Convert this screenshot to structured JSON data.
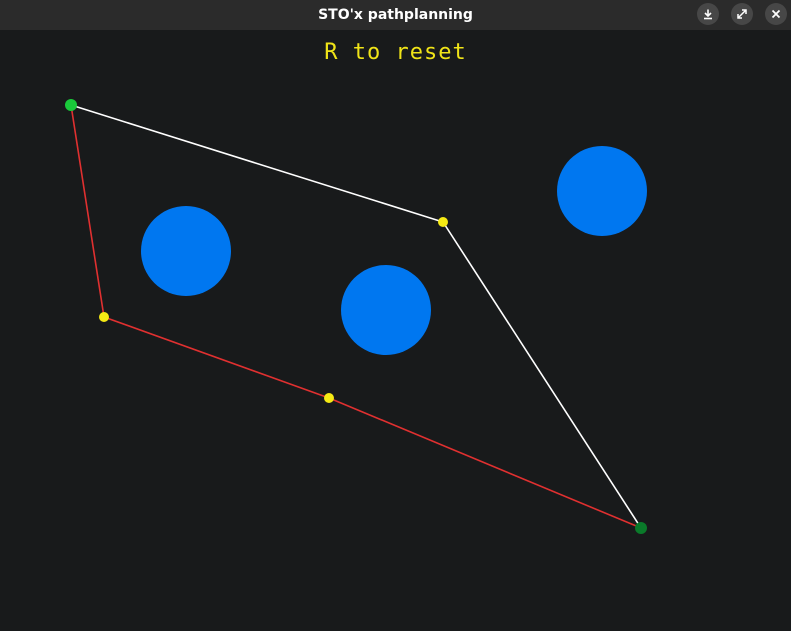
{
  "window": {
    "title": "STO'x pathplanning",
    "buttons": [
      {
        "name": "download-button",
        "icon": "download-icon"
      },
      {
        "name": "maximize-button",
        "icon": "maximize-icon"
      },
      {
        "name": "close-button",
        "icon": "close-icon"
      }
    ]
  },
  "canvas": {
    "hint": "R to reset",
    "colors": {
      "background": "#181a1b",
      "obstacle": "#0077f0",
      "start": "#19c93a",
      "goal": "#0a7a2a",
      "waypoint": "#f5ea14",
      "path_white": "#ffffff",
      "path_red": "#e03030",
      "hint": "#f0e418"
    }
  }
}
